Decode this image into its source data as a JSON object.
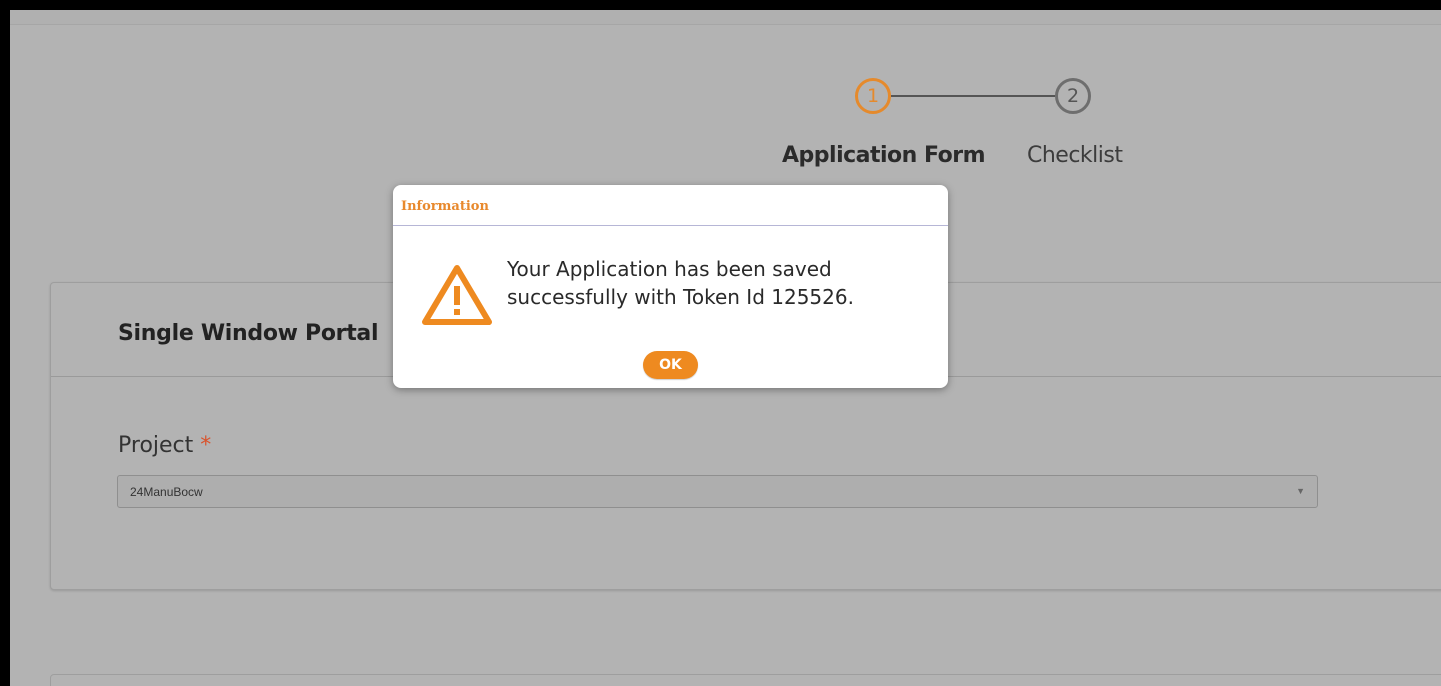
{
  "stepper": {
    "steps": [
      {
        "number": "1",
        "label": "Application Form",
        "active": true
      },
      {
        "number": "2",
        "label": "Checklist",
        "active": false
      }
    ]
  },
  "card": {
    "title": "Single Window Portal",
    "project_label": "Project",
    "required_marker": "*",
    "project_value": "24ManuBocw"
  },
  "dialog": {
    "title": "Information",
    "message": "Your Application has been saved successfully with Token Id 125526.",
    "ok_label": "OK"
  },
  "colors": {
    "accent": "#ee8a20",
    "required": "#d9532c",
    "background": "#b3b3b3"
  },
  "icons": {
    "dialog": "warning-icon",
    "select": "caret-down-icon"
  }
}
